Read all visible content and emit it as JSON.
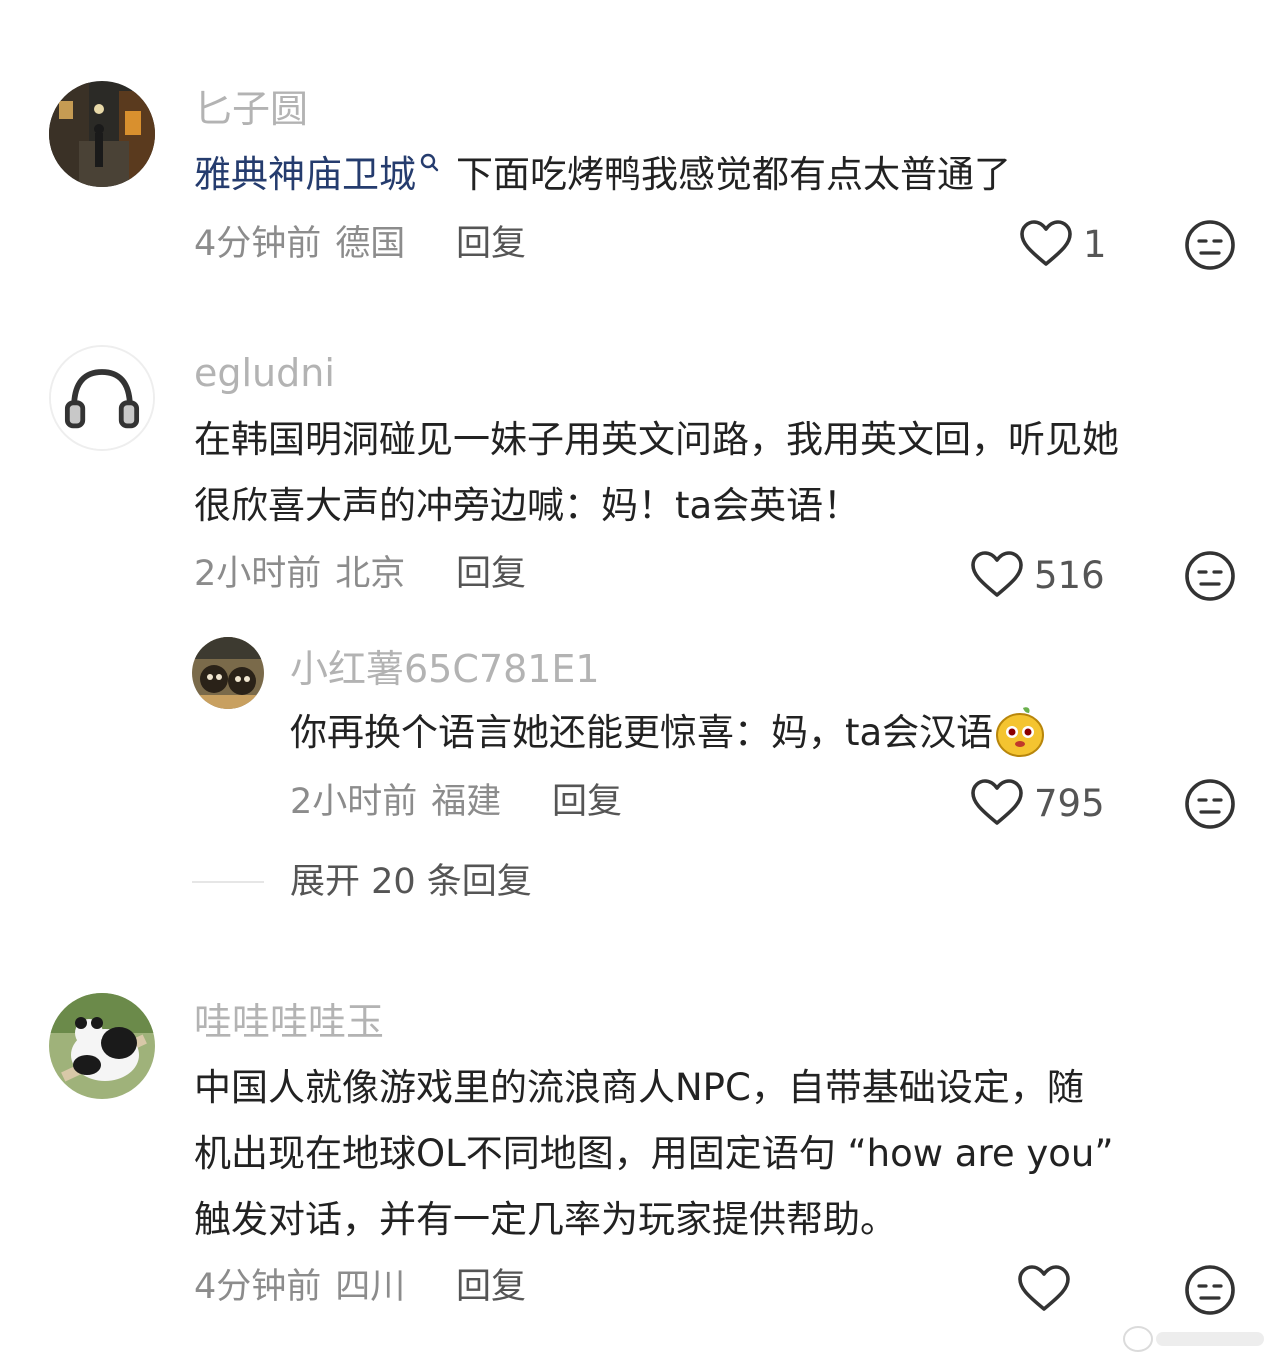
{
  "comments": [
    {
      "username": "匕子圆",
      "mention": "雅典神庙卫城",
      "text": "下面吃烤鸭我感觉都有点太普通了",
      "time": "4分钟前",
      "location": "德国",
      "reply_label": "回复",
      "likes": "1"
    },
    {
      "username": "egludni",
      "line1": "在韩国明洞碰见一妹子用英文问路，我用英文回，听见她",
      "line2": "很欣喜大声的冲旁边喊：妈！ta会英语！",
      "time": "2小时前",
      "location": "北京",
      "reply_label": "回复",
      "likes": "516",
      "sub_reply": {
        "username": "小红薯65C781E1",
        "text": "你再换个语言她还能更惊喜：妈，ta会汉语",
        "time": "2小时前",
        "location": "福建",
        "reply_label": "回复",
        "likes": "795"
      },
      "expand_label": "展开 20 条回复"
    },
    {
      "username": "哇哇哇哇玉",
      "line1": "中国人就像游戏里的流浪商人NPC，自带基础设定，随",
      "line2": "机出现在地球OL不同地图，用固定语句 “how are you”",
      "line3": "触发对话，并有一定几率为玩家提供帮助。",
      "time": "4分钟前",
      "location": "四川",
      "reply_label": "回复",
      "likes": ""
    }
  ],
  "icons": {
    "like": "heart-outline-icon",
    "dislike": "neutral-face-icon",
    "mention": "search-icon",
    "emoji": "potato-emoji"
  },
  "colors": {
    "username": "#b3b3b3",
    "mention": "#253c6e",
    "meta": "#8c8c8c",
    "body": "#222222"
  }
}
